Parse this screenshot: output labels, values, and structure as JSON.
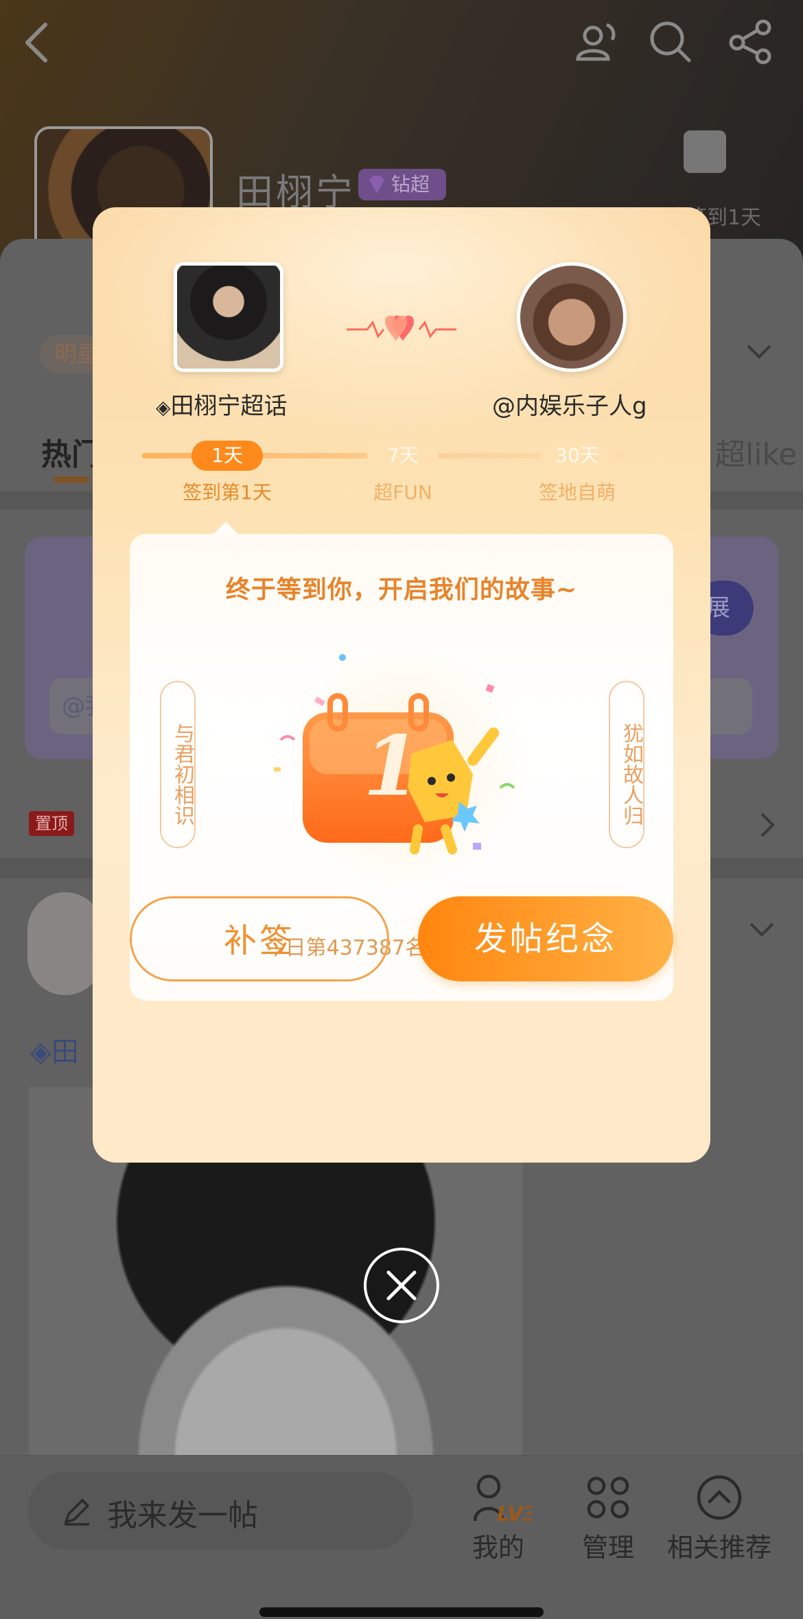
{
  "background": {
    "title": "田栩宁",
    "badge": "钻超",
    "checkin_text": "连续签到1天",
    "tag": "明星",
    "tab_hot": "热门",
    "tab_like": "超like",
    "card_button": "展",
    "card_input": "@我",
    "pin_label": "置顶",
    "post_gem_text": "◈田"
  },
  "bottom_bar": {
    "post_placeholder": "我来发一帖",
    "nav": [
      {
        "label": "我的",
        "icon": "lv-profile-icon",
        "badge": "LV3"
      },
      {
        "label": "管理",
        "icon": "manage-icon"
      },
      {
        "label": "相关推荐",
        "icon": "recommend-icon"
      }
    ]
  },
  "modal": {
    "star_name": "田栩宁超话",
    "user_name": "@内娱乐子人g",
    "milestones": [
      {
        "pill": "1天",
        "label": "签到第1天",
        "active": true
      },
      {
        "pill": "7天",
        "label": "超FUN",
        "active": false
      },
      {
        "pill": "30天",
        "label": "签地自萌",
        "active": false
      }
    ],
    "headline": "终于等到你，开启我们的故事~",
    "left_verse": "与君初相识",
    "right_verse": "犹如故人归",
    "calendar_number": "1",
    "rank_text": "今日第437387名，经验值+4",
    "btn_makeup": "补签",
    "btn_post": "发帖纪念"
  },
  "colors": {
    "accent": "#ff8a1c",
    "accent_text": "#e8832a",
    "modal_bg": "#fde3b6"
  }
}
